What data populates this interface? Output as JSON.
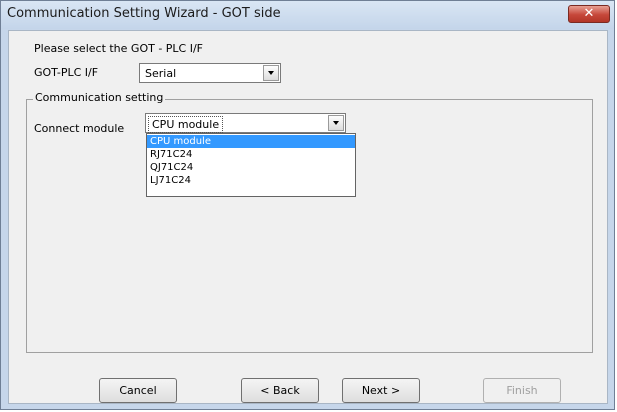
{
  "window": {
    "title": "Communication Setting Wizard - GOT side",
    "close_glyph": "✕"
  },
  "interface": {
    "prompt": "Please select the GOT - PLC I/F",
    "label": "GOT-PLC I/F",
    "selected": "Serial"
  },
  "communication_setting": {
    "group_title": "Communication setting",
    "connect_module_label": "Connect module",
    "connect_module_selected": "CPU module",
    "options": [
      "CPU module",
      "RJ71C24",
      "QJ71C24",
      "LJ71C24"
    ],
    "highlighted_index": 0
  },
  "buttons": {
    "cancel": "Cancel",
    "back": "< Back",
    "next": "Next >",
    "finish": "Finish"
  },
  "colors": {
    "highlight": "#3399ff",
    "title_bar": "#c6d6ea",
    "close_button": "#c6473a"
  }
}
